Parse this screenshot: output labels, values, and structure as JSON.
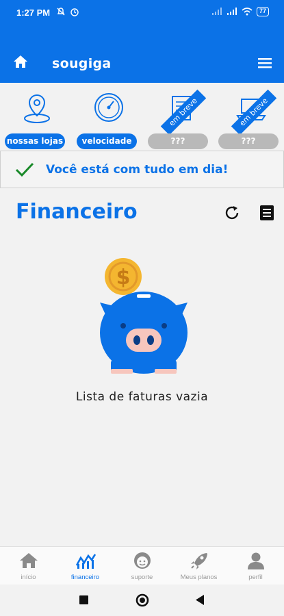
{
  "status_bar": {
    "time": "1:27 PM",
    "battery": "77",
    "icons": [
      "mute-icon",
      "alarm-icon",
      "signal-icon",
      "signal-icon",
      "wifi-icon",
      "battery-icon"
    ]
  },
  "app_bar": {
    "brand": "sougiga",
    "home_icon": "home-icon",
    "menu_icon": "hamburger-menu-icon"
  },
  "shortcuts": [
    {
      "label": "nossas lojas",
      "icon": "map-pin-icon",
      "enabled": true
    },
    {
      "label": "velocidade",
      "icon": "speedometer-icon",
      "enabled": true
    },
    {
      "label": "???",
      "icon": "document-icon",
      "enabled": false,
      "ribbon": "em breve"
    },
    {
      "label": "???",
      "icon": "laptop-icon",
      "enabled": false,
      "ribbon": "em breve"
    }
  ],
  "alert": {
    "message": "Você está com tudo em dia!",
    "icon": "check-icon"
  },
  "section": {
    "title": "Financeiro",
    "empty_message": "Lista de faturas vazia",
    "actions": [
      "refresh-icon",
      "list-icon"
    ]
  },
  "bottom_nav": [
    {
      "label": "início",
      "icon": "home-icon",
      "active": false
    },
    {
      "label": "financeiro",
      "icon": "chart-icon",
      "active": true
    },
    {
      "label": "suporte",
      "icon": "support-face-icon",
      "active": false
    },
    {
      "label": "Meus planos",
      "icon": "rocket-icon",
      "active": false
    },
    {
      "label": "perfil",
      "icon": "user-icon",
      "active": false
    }
  ],
  "colors": {
    "brand_blue": "#0b72e7",
    "coin_gold": "#f4b630",
    "disabled_gray": "#b9b9b9",
    "background": "#f2f2f2"
  }
}
